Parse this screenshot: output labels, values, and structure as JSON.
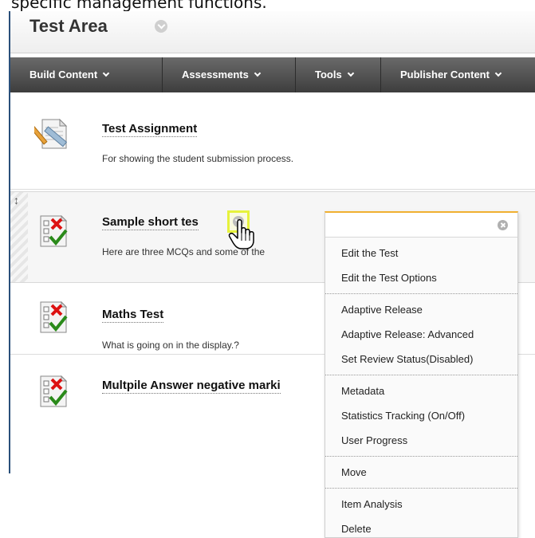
{
  "caption": "specific management functions.",
  "page": {
    "title": "Test Area"
  },
  "menubar": {
    "items": [
      {
        "label": "Build Content"
      },
      {
        "label": "Assessments"
      },
      {
        "label": "Tools"
      },
      {
        "label": "Publisher Content"
      }
    ]
  },
  "content_items": [
    {
      "title": "Test Assignment",
      "description": "For showing the student submission process.",
      "icon": "assignment-icon"
    },
    {
      "title": "Sample short tes",
      "description": "Here are three MCQs and some of the",
      "icon": "test-icon"
    },
    {
      "title": "Maths Test",
      "description": "What is going on in the display.?",
      "icon": "test-icon"
    },
    {
      "title": "Multpile Answer negative marki",
      "description": "",
      "icon": "test-icon"
    }
  ],
  "context_menu": {
    "groups": [
      [
        "Edit the Test",
        "Edit the Test Options"
      ],
      [
        "Adaptive Release",
        "Adaptive Release: Advanced",
        "Set Review Status(Disabled)"
      ],
      [
        "Metadata",
        "Statistics Tracking (On/Off)",
        "User Progress"
      ],
      [
        "Move"
      ],
      [
        "Item Analysis",
        "Delete"
      ]
    ]
  },
  "colors": {
    "menubar": "#4a4a4a",
    "highlight": "#e6f23c",
    "accent_border": "#f0b030"
  }
}
